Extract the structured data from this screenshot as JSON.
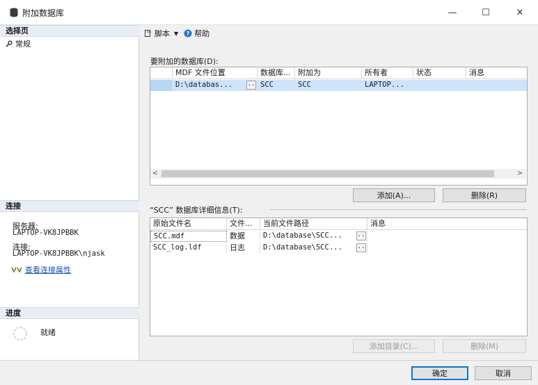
{
  "window": {
    "title": "附加数据库",
    "controls": {
      "minimize": "—",
      "maximize": "☐",
      "close": "✕"
    }
  },
  "left": {
    "select_page_header": "选择页",
    "nav_items": [
      {
        "label": "常规",
        "icon": "wrench-icon"
      }
    ],
    "connection_header": "连接",
    "server_label": "服务器:",
    "server_value": "LAPTOP-VK8JPBBK",
    "connection_label": "连接:",
    "connection_value": "LAPTOP-VK8JPBBK\\njask",
    "view_connection_link": "查看连接属性",
    "progress_header": "进度",
    "progress_status": "就绪"
  },
  "toolbar": {
    "script_label": "脚本",
    "help_label": "帮助"
  },
  "attach_grid": {
    "label": "要附加的数据库(D):",
    "columns": [
      "MDF 文件位置",
      "数据库...",
      "附加为",
      "所有者",
      "状态",
      "消息"
    ],
    "rows": [
      {
        "mdf": "D:\\databas...",
        "db": "SCC",
        "attach_as": "SCC",
        "owner": "LAPTOP...",
        "status": "",
        "message": ""
      }
    ],
    "add_button": "添加(A)...",
    "remove_button": "删除(R)"
  },
  "details": {
    "label": "“SCC” 数据库详细信息(T):",
    "columns": [
      "原始文件名",
      "文件...",
      "当前文件路径",
      "消息"
    ],
    "rows": [
      {
        "name": "SCC.mdf",
        "type": "数据",
        "path": "D:\\database\\SCC...",
        "message": ""
      },
      {
        "name": "SCC_log.ldf",
        "type": "日志",
        "path": "D:\\database\\SCC...",
        "message": ""
      }
    ],
    "add_catalog_button": "添加目录(C)...",
    "remove_button": "删除(M)"
  },
  "footer": {
    "ok_button": "确定",
    "cancel_button": "取消"
  },
  "colors": {
    "selection": "#cde4fb",
    "link": "#1a4fb5",
    "accent": "#0078d7"
  }
}
